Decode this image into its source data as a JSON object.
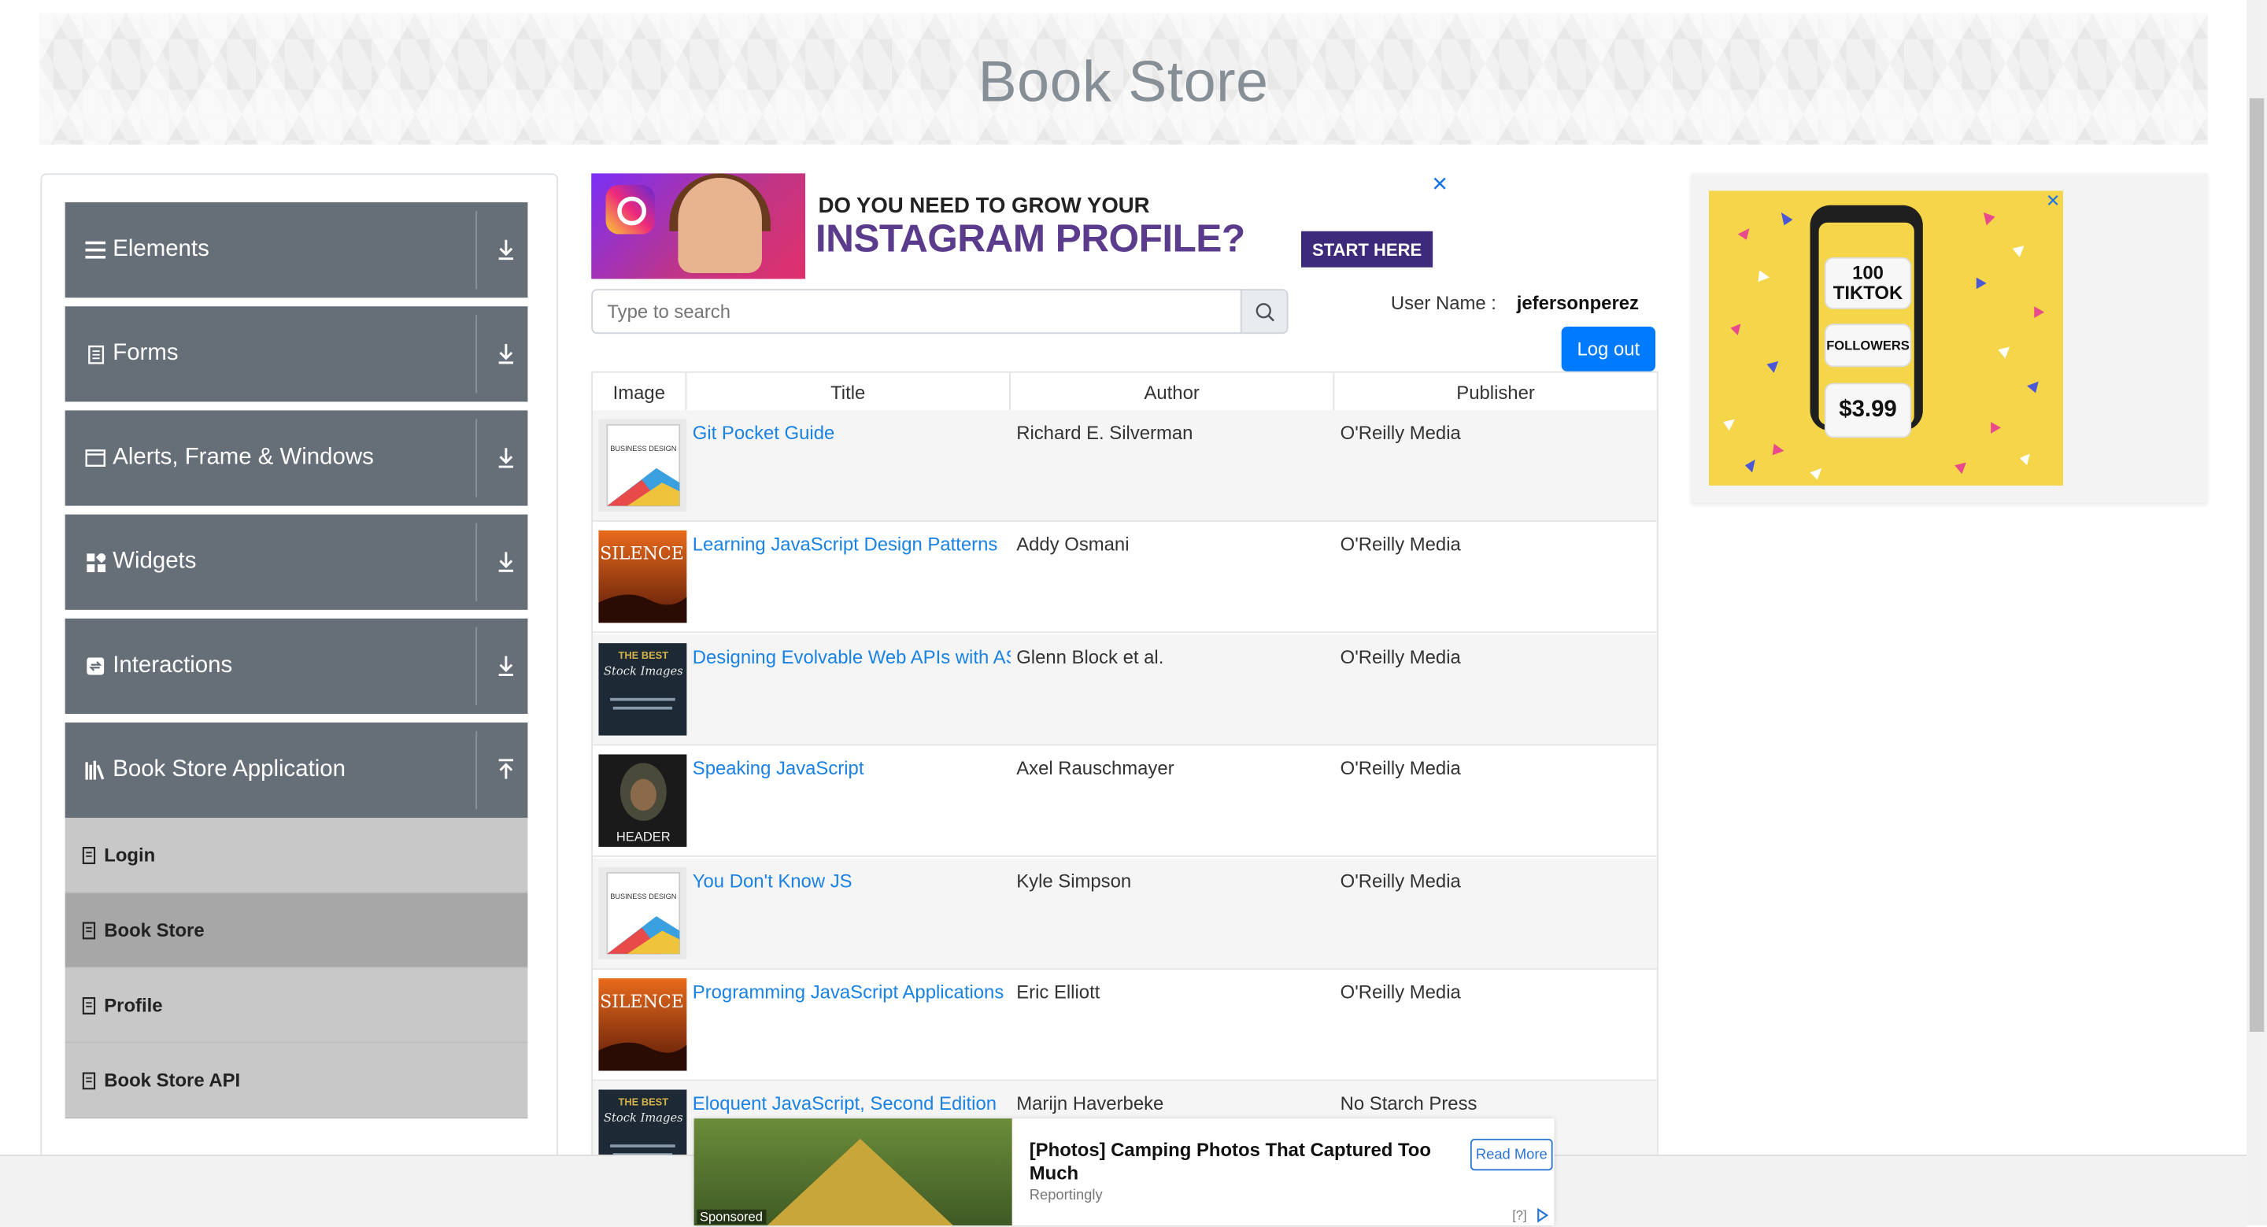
{
  "header": {
    "title": "Book Store"
  },
  "sidebar": {
    "groups": [
      {
        "label": "Elements",
        "icon": "menu-icon"
      },
      {
        "label": "Forms",
        "icon": "form-icon"
      },
      {
        "label": "Alerts, Frame & Windows",
        "icon": "window-icon"
      },
      {
        "label": "Widgets",
        "icon": "widgets-icon"
      },
      {
        "label": "Interactions",
        "icon": "interactions-icon"
      },
      {
        "label": "Book Store Application",
        "icon": "books-icon"
      }
    ],
    "book_store_items": [
      {
        "label": "Login",
        "active": false
      },
      {
        "label": "Book Store",
        "active": true
      },
      {
        "label": "Profile",
        "active": false
      },
      {
        "label": "Book Store API",
        "active": false
      }
    ]
  },
  "ad_top": {
    "question": "DO YOU NEED TO GROW YOUR",
    "headline": "INSTAGRAM PROFILE?",
    "cta": "START HERE",
    "close": "✕"
  },
  "search": {
    "placeholder": "Type to search",
    "value": ""
  },
  "user": {
    "label": "User Name :",
    "name": "jefersonperez",
    "logout": "Log out"
  },
  "table": {
    "headers": [
      "Image",
      "Title",
      "Author",
      "Publisher"
    ],
    "rows": [
      {
        "title": "Git Pocket Guide",
        "author": "Richard E. Silverman",
        "publisher": "O'Reilly Media",
        "cover": "business-design"
      },
      {
        "title": "Learning JavaScript Design Patterns",
        "author": "Addy Osmani",
        "publisher": "O'Reilly Media",
        "cover": "silence"
      },
      {
        "title": "Designing Evolvable Web APIs with ASP.NET",
        "author": "Glenn Block et al.",
        "publisher": "O'Reilly Media",
        "cover": "best-stock"
      },
      {
        "title": "Speaking JavaScript",
        "author": "Axel Rauschmayer",
        "publisher": "O'Reilly Media",
        "cover": "header"
      },
      {
        "title": "You Don't Know JS",
        "author": "Kyle Simpson",
        "publisher": "O'Reilly Media",
        "cover": "business-design"
      },
      {
        "title": "Programming JavaScript Applications",
        "author": "Eric Elliott",
        "publisher": "O'Reilly Media",
        "cover": "silence"
      },
      {
        "title": "Eloquent JavaScript, Second Edition",
        "author": "Marijn Haverbeke",
        "publisher": "No Starch Press",
        "cover": "best-stock"
      }
    ]
  },
  "cover_text": {
    "business": "BUSINESS DESIGN",
    "silence": "SILENCE",
    "best": "THE BEST",
    "stock": "Stock Images",
    "header": "HEADER"
  },
  "ad_right": {
    "count": "100",
    "brand": "TIKTOK",
    "followers": "FOLLOWERS",
    "price": "$3.99",
    "close": "✕"
  },
  "ad_bottom": {
    "headline": "[Photos] Camping Photos That Captured Too Much",
    "source": "Reportingly",
    "cta": "Read More",
    "sponsored": "Sponsored",
    "info": "[?]"
  },
  "colors": {
    "accent": "#007bff",
    "sidebar": "#666e78",
    "link": "#1a82e2"
  }
}
